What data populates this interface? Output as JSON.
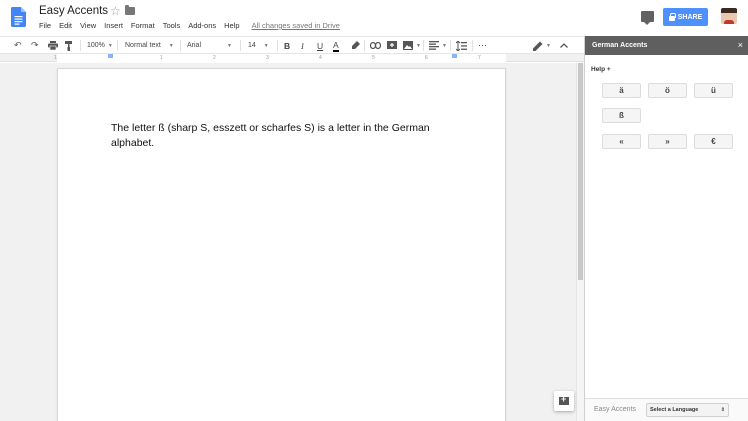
{
  "header": {
    "title": "Easy Accents",
    "star_glyph": "☆",
    "menu": [
      "File",
      "Edit",
      "View",
      "Insert",
      "Format",
      "Tools",
      "Add-ons",
      "Help"
    ],
    "save_status": "All changes saved in Drive",
    "share_label": "SHARE",
    "accent_color": "#4d90fe"
  },
  "toolbar": {
    "zoom": "100%",
    "style": "Normal text",
    "font": "Arial",
    "size": "14",
    "bold": "B",
    "italic": "I",
    "underline": "U",
    "text_color": "A",
    "more": "⋯"
  },
  "ruler": {
    "numbers": [
      "1",
      "1",
      "2",
      "3",
      "4",
      "5",
      "6",
      "7"
    ]
  },
  "document": {
    "body": "The letter ß (sharp S, esszett or scharfes S) is a letter in the German alphabet."
  },
  "sidebar": {
    "title": "German Accents",
    "close_glyph": "×",
    "help_label": "Help +",
    "buttons": [
      "ä",
      "ö",
      "ü",
      "ß",
      "«",
      "»",
      "€"
    ],
    "footer_label": "Easy Accents",
    "language_select": "Select a Language",
    "language_caret": "⇕"
  }
}
